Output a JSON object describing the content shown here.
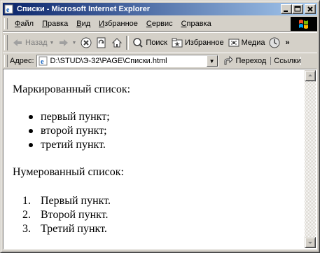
{
  "window": {
    "title": "Списки - Microsoft Internet Explorer"
  },
  "menu": {
    "items": [
      {
        "underlined": "Ф",
        "rest": "айл"
      },
      {
        "underlined": "П",
        "rest": "равка"
      },
      {
        "underlined": "В",
        "rest": "ид"
      },
      {
        "underlined": "И",
        "rest": "збранное"
      },
      {
        "underlined": "С",
        "rest": "ервис"
      },
      {
        "underlined": "С",
        "rest": "правка"
      }
    ]
  },
  "toolbar": {
    "back_label": "Назад",
    "search_label": "Поиск",
    "favorites_label": "Избранное",
    "media_label": "Медиа"
  },
  "address": {
    "label": "Адрес:",
    "value": "D:\\STUD\\Э-32\\PAGE\\Списки.html",
    "go_label": "Переход",
    "links_label": "Ссылки"
  },
  "content": {
    "bulleted_heading": "Маркированный список:",
    "bulleted_items": [
      "первый пункт;",
      "второй пункт;",
      "третий пункт."
    ],
    "numbered_heading": "Нумерованный список:",
    "numbered_items": [
      {
        "num": "1.",
        "text": "Первый пункт."
      },
      {
        "num": "2.",
        "text": "Второй пункт."
      },
      {
        "num": "3.",
        "text": "Третий пункт."
      }
    ]
  },
  "colors": {
    "title_gradient_start": "#0a246a",
    "title_gradient_end": "#a6caf0",
    "chrome": "#d4d0c8"
  }
}
